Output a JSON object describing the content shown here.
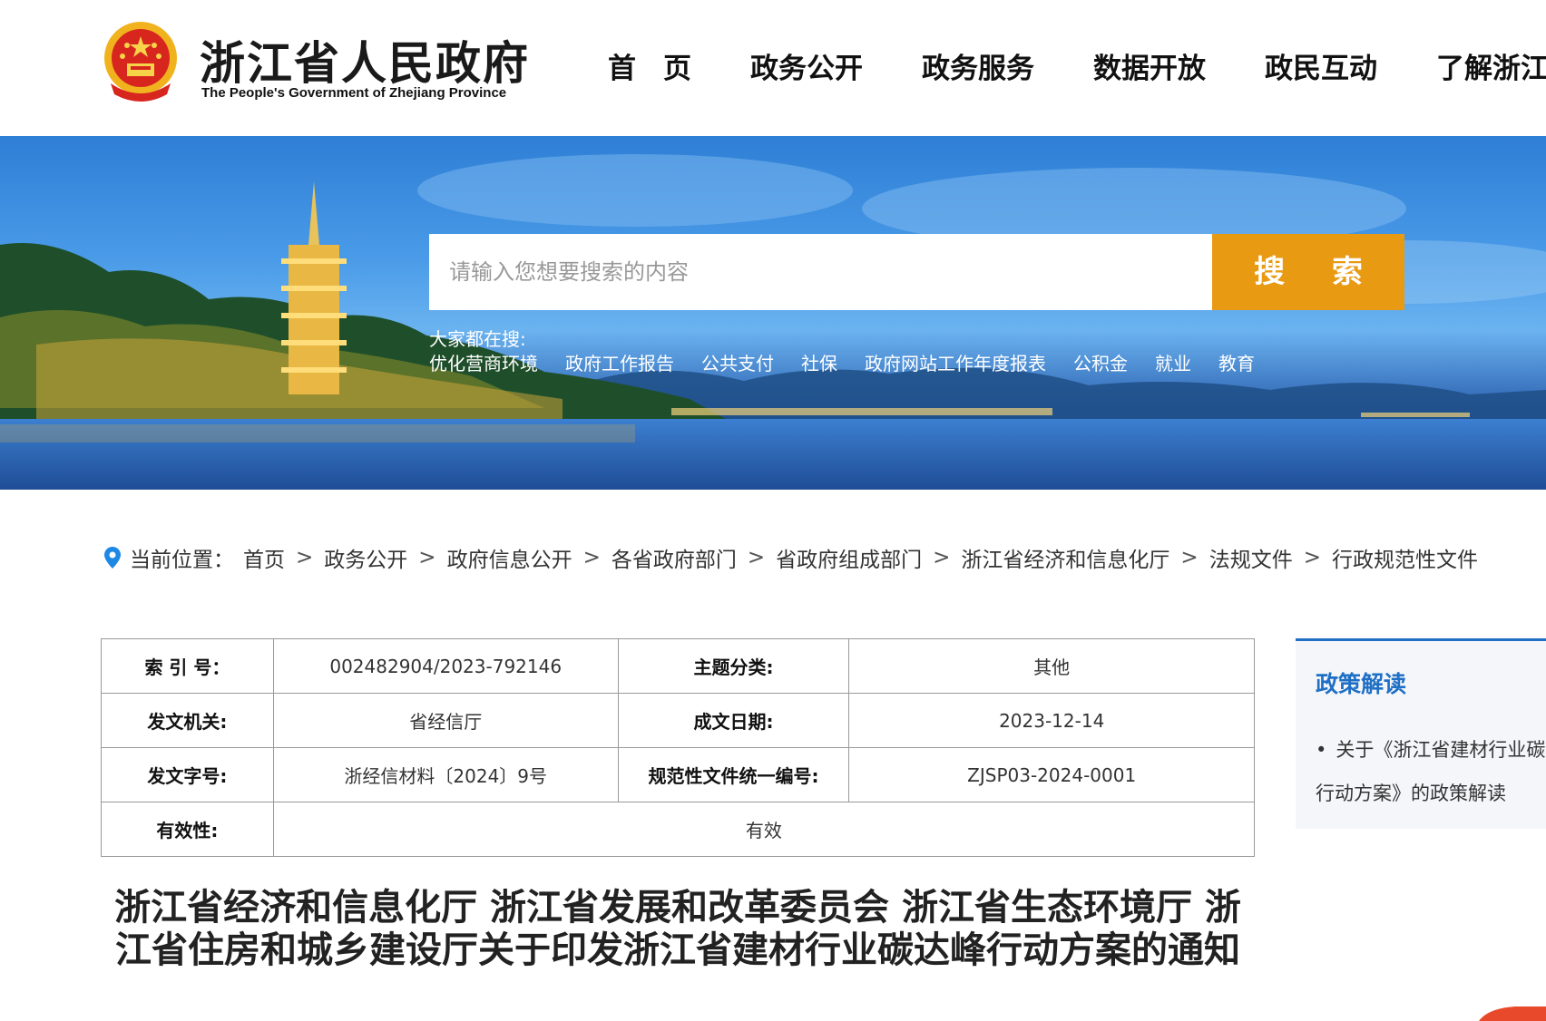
{
  "header": {
    "site_name": "浙江省人民政府",
    "site_name_en": "The People's Government of Zhejiang Province",
    "nav": [
      "首页",
      "政务公开",
      "政务服务",
      "数据开放",
      "政民互动",
      "了解浙江"
    ]
  },
  "search": {
    "placeholder": "请输入您想要搜索的内容",
    "button_label": "搜 索",
    "hot_label": "大家都在搜:",
    "hot_items": [
      "优化营商环境",
      "政府工作报告",
      "公共支付",
      "社保",
      "政府网站工作年度报表",
      "公积金",
      "就业",
      "教育"
    ]
  },
  "breadcrumb": {
    "prefix": "当前位置：",
    "items": [
      "首页",
      "政务公开",
      "政府信息公开",
      "各省政府部门",
      "省政府组成部门",
      "浙江省经济和信息化厅",
      "法规文件",
      "行政规范性文件"
    ],
    "separator": ">"
  },
  "meta": {
    "index_label": "索 引 号：",
    "index_value": "002482904/2023-792146",
    "topic_label": "主题分类:",
    "topic_value": "其他",
    "issuer_label": "发文机关:",
    "issuer_value": "省经信厅",
    "date_label": "成文日期:",
    "date_value": "2023-12-14",
    "docno_label": "发文字号:",
    "docno_value": "浙经信材料〔2024〕9号",
    "code_label": "规范性文件统一编号:",
    "code_value": "ZJSP03-2024-0001",
    "validity_label": "有效性:",
    "validity_value": "有效"
  },
  "document": {
    "title": "浙江省经济和信息化厅 浙江省发展和改革委员会 浙江省生态环境厅 浙江省住房和城乡建设厅关于印发浙江省建材行业碳达峰行动方案的通知"
  },
  "sidebar": {
    "title": "政策解读",
    "link_text": "关于《浙江省建材行业碳达峰行动方案》的政策解读"
  },
  "colors": {
    "search_button": "#e89a12",
    "sidebar_accent": "#1f6fc5"
  }
}
